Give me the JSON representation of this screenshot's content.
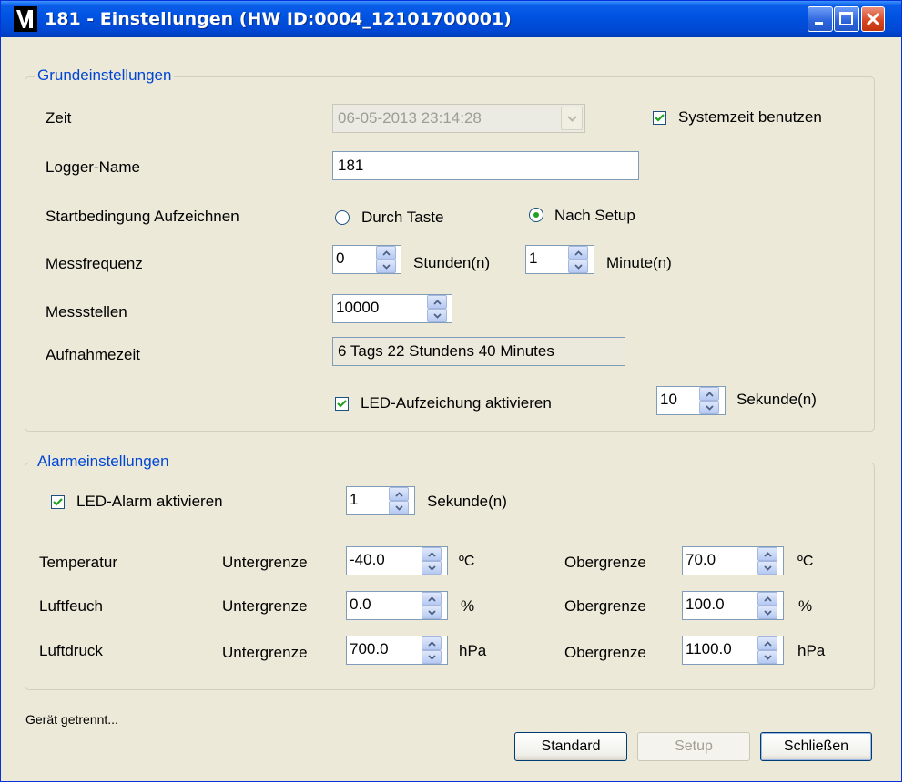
{
  "window": {
    "title": "181 - Einstellungen (HW ID:0004_12101700001)"
  },
  "basic": {
    "legend": "Grundeinstellungen",
    "time_label": "Zeit",
    "time_value": "06-05-2013 23:14:28",
    "systemzeit_label": "Systemzeit benutzen",
    "systemzeit_checked": true,
    "logger_name_label": "Logger-Name",
    "logger_name_value": "181",
    "start_label": "Startbedingung Aufzeichnen",
    "start_option_1": "Durch Taste",
    "start_option_2": "Nach Setup",
    "start_selected": "Nach Setup",
    "freq_label": "Messfrequenz",
    "freq_hours_value": "0",
    "freq_hours_unit": "Stunden(n)",
    "freq_minutes_value": "1",
    "freq_minutes_unit": "Minute(n)",
    "points_label": "Messstellen",
    "points_value": "10000",
    "duration_label": "Aufnahmezeit",
    "duration_value": "6 Tags 22 Stundens 40 Minutes",
    "led_record_label": "LED-Aufzeichung aktivieren",
    "led_record_checked": true,
    "led_record_seconds": "10",
    "led_record_unit": "Sekunde(n)"
  },
  "alarm": {
    "legend": "Alarmeinstellungen",
    "led_alarm_label": "LED-Alarm aktivieren",
    "led_alarm_checked": true,
    "led_alarm_seconds": "1",
    "led_alarm_unit": "Sekunde(n)",
    "lower_label": "Untergrenze",
    "upper_label": "Obergrenze",
    "rows": [
      {
        "name": "Temperatur",
        "lower": "-40.0",
        "upper": "70.0",
        "unit": "ºC"
      },
      {
        "name": "Luftfeuch",
        "lower": "0.0",
        "upper": "100.0",
        "unit": "%"
      },
      {
        "name": "Luftdruck",
        "lower": "700.0",
        "upper": "1100.0",
        "unit": "hPa"
      }
    ]
  },
  "status_text": "Gerät getrennt...",
  "buttons": {
    "standard": "Standard",
    "setup": "Setup",
    "close": "Schließen"
  },
  "colors": {
    "titlebar": "#0054e3",
    "legend_text": "#0046d5",
    "dialog_bg": "#ece9d8"
  }
}
